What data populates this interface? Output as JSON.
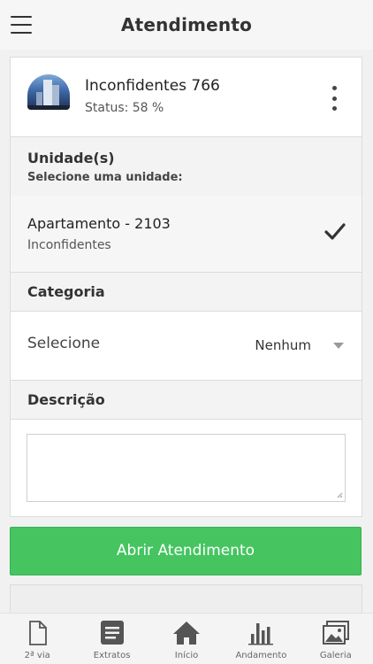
{
  "header": {
    "title": "Atendimento"
  },
  "property": {
    "name": "Inconfidentes 766",
    "status": "Status: 58 %"
  },
  "units_section": {
    "title": "Unidade(s)",
    "subtitle": "Selecione uma unidade:"
  },
  "unit": {
    "name": "Apartamento - 2103",
    "building": "Inconfidentes"
  },
  "category_section": {
    "title": "Categoria"
  },
  "category_select": {
    "label": "Selecione",
    "value": "Nenhum"
  },
  "description_section": {
    "title": "Descrição"
  },
  "description_input": {
    "value": "",
    "placeholder": ""
  },
  "submit": {
    "label": "Abrir Atendimento"
  },
  "colors": {
    "primary_button": "#45c460",
    "background": "#f1f1f1"
  },
  "bottom_nav": [
    {
      "label": "2ª via",
      "icon": "file-icon"
    },
    {
      "label": "Extratos",
      "icon": "document-list-icon"
    },
    {
      "label": "Início",
      "icon": "home-icon"
    },
    {
      "label": "Andamento",
      "icon": "bar-chart-icon"
    },
    {
      "label": "Galeria",
      "icon": "gallery-icon"
    }
  ]
}
